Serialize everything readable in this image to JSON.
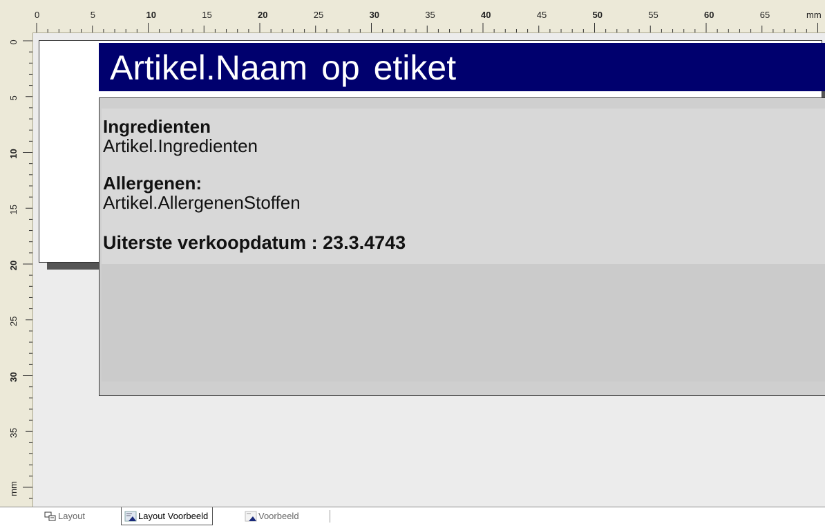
{
  "ruler": {
    "unit_label": "mm",
    "h_numbers": [
      "0",
      "5",
      "10",
      "15",
      "20",
      "25",
      "30",
      "35",
      "40",
      "45",
      "50",
      "55",
      "60",
      "65"
    ],
    "v_numbers": [
      "0",
      "5",
      "10",
      "15",
      "20",
      "25",
      "30",
      "35"
    ]
  },
  "label": {
    "name_field": "Artikel.Naam  op  etiket",
    "ingredients_heading": "Ingredienten",
    "ingredients_value": "Artikel.Ingredienten",
    "allergens_heading": "Allergenen:",
    "allergens_value": "Artikel.AllergenenStoffen",
    "sell_by": "Uiterste verkoopdatum : 23.3.4743"
  },
  "tabs": [
    {
      "label": "Layout",
      "icon": "layout-icon",
      "active": false
    },
    {
      "label": "Layout Voorbeeld",
      "icon": "layout-preview-icon",
      "active": true
    },
    {
      "label": "Voorbeeld",
      "icon": "preview-icon",
      "active": false
    }
  ],
  "colors": {
    "name_bar": "#00006e",
    "ruler_bg": "#ece9d8",
    "canvas_bg": "#ececec"
  }
}
